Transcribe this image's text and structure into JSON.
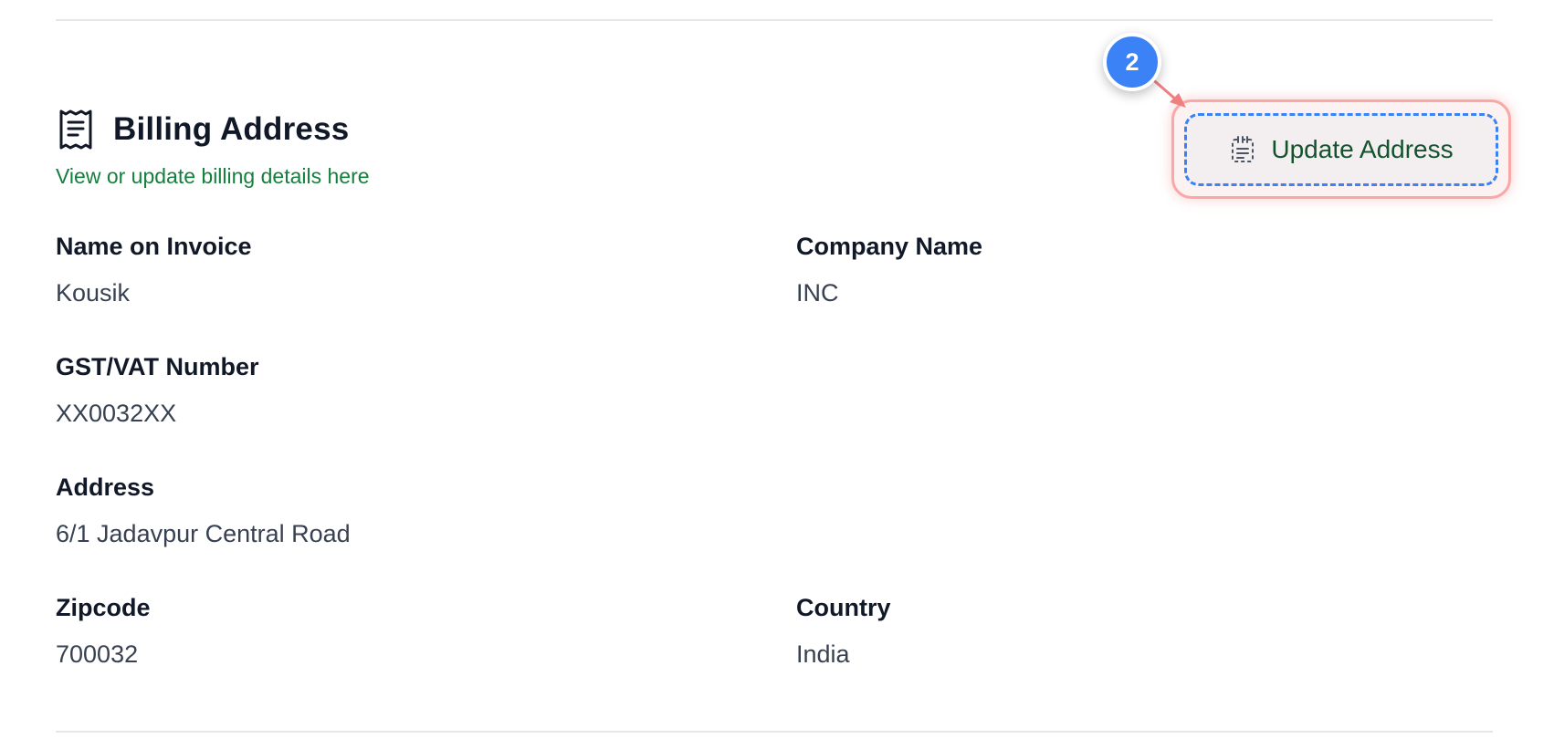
{
  "section": {
    "title": "Billing Address",
    "subtitle": "View or update billing details here",
    "icon": "receipt-icon"
  },
  "update_button": {
    "label": "Update Address",
    "icon": "document-edit-icon"
  },
  "annotation": {
    "step_number": "2"
  },
  "fields": {
    "name_on_invoice": {
      "label": "Name on Invoice",
      "value": "Kousik"
    },
    "company_name": {
      "label": "Company Name",
      "value": "INC"
    },
    "gst_vat": {
      "label": "GST/VAT Number",
      "value": "XX0032XX"
    },
    "address": {
      "label": "Address",
      "value": "6/1 Jadavpur Central Road"
    },
    "zipcode": {
      "label": "Zipcode",
      "value": "700032"
    },
    "country": {
      "label": "Country",
      "value": "India"
    }
  },
  "colors": {
    "subtitle_green": "#15803d",
    "button_text": "#14532d",
    "badge_blue": "#3b82f6",
    "highlight_red": "#f9a8a8"
  }
}
